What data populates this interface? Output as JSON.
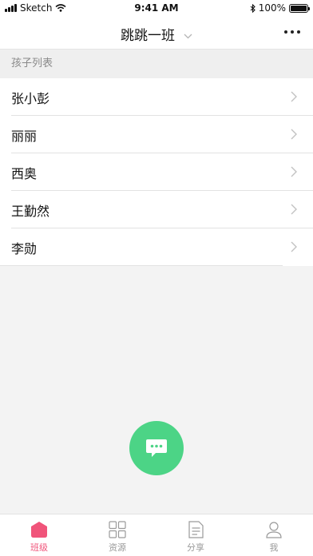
{
  "status_bar": {
    "carrier": "Sketch",
    "time": "9:41 AM",
    "battery": "100%"
  },
  "nav": {
    "title": "跳跳一班"
  },
  "section": {
    "header": "孩子列表"
  },
  "children": [
    {
      "name": "张小彭"
    },
    {
      "name": "丽丽"
    },
    {
      "name": "西奥"
    },
    {
      "name": "王勤然"
    },
    {
      "name": "李勋"
    }
  ],
  "tabs": [
    {
      "label": "班级",
      "icon": "home-icon",
      "active": true
    },
    {
      "label": "资源",
      "icon": "grid-icon",
      "active": false
    },
    {
      "label": "分享",
      "icon": "document-icon",
      "active": false
    },
    {
      "label": "我",
      "icon": "person-icon",
      "active": false
    }
  ],
  "colors": {
    "accent": "#f0547a",
    "fab": "#4cd486"
  }
}
